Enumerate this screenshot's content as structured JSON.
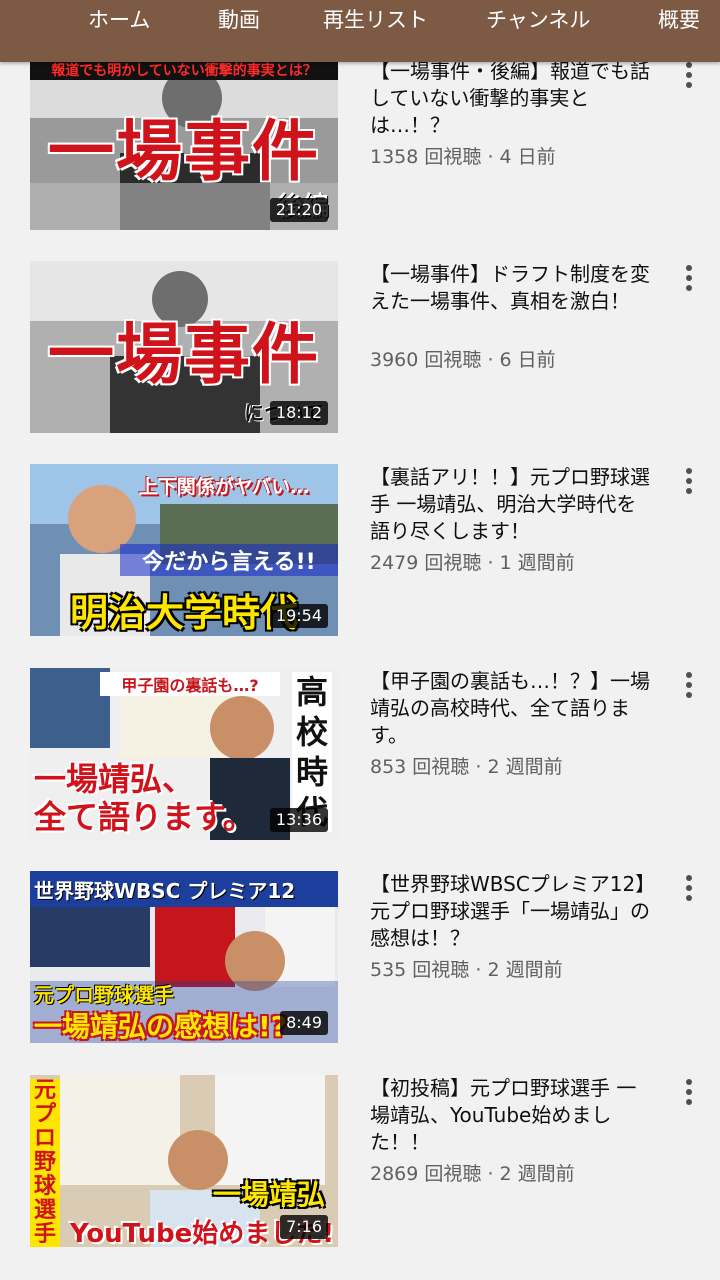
{
  "nav": {
    "tabs": [
      "ホーム",
      "動画",
      "再生リスト",
      "チャンネル",
      "概要"
    ]
  },
  "colors": {
    "topbar": "#7d5a44",
    "background": "#f1f1f1",
    "accent_red": "#c4161c"
  },
  "videos": [
    {
      "title": "【一場事件・後編】報道でも話していない衝撃的事実とは…！？",
      "views": "1358 回視聴",
      "age": "4 日前",
      "duration": "21:20",
      "thumb_text_top": "報道でも明かしていない衝撃的事実とは？",
      "thumb_text_main": "一場事件",
      "thumb_text_sub": "後編"
    },
    {
      "title": "【一場事件】ドラフト制度を変えた一場事件、真相を激白！",
      "views": "3960 回視聴",
      "age": "6 日前",
      "duration": "18:12",
      "thumb_text_main": "一場事件",
      "thumb_text_sub": "について"
    },
    {
      "title": "【裏話アリ！！】元プロ野球選手 一場靖弘、明治大学時代を語り尽くします！",
      "views": "2479 回視聴",
      "age": "1 週間前",
      "duration": "19:54",
      "thumb_text_top": "上下関係がヤバい…",
      "thumb_text_main": "明治大学時代",
      "thumb_text_sub": "今だから言える!!"
    },
    {
      "title": "【甲子園の裏話も…！？】一場靖弘の高校時代、全て語ります。",
      "views": "853 回視聴",
      "age": "2 週間前",
      "duration": "13:36",
      "thumb_text_top": "甲子園の裏話も…?",
      "thumb_text_main": "一場靖弘、",
      "thumb_text_main2": "全て語ります。",
      "thumb_text_side": "高校時代"
    },
    {
      "title": "【世界野球WBSCプレミア12】元プロ野球選手「一場靖弘」の感想は！？",
      "views": "535 回視聴",
      "age": "2 週間前",
      "duration": "8:49",
      "thumb_text_top": "世界野球WBSC プレミア12",
      "thumb_text_main": "一場靖弘の感想は!?",
      "thumb_text_sub": "元プロ野球選手"
    },
    {
      "title": "【初投稿】元プロ野球選手 一場靖弘、YouTube始めました！！",
      "views": "2869 回視聴",
      "age": "2 週間前",
      "duration": "7:16",
      "thumb_text_side": "元プロ野球選手",
      "thumb_text_main": "一場靖弘",
      "thumb_text_sub": "YouTube始めました!"
    }
  ]
}
